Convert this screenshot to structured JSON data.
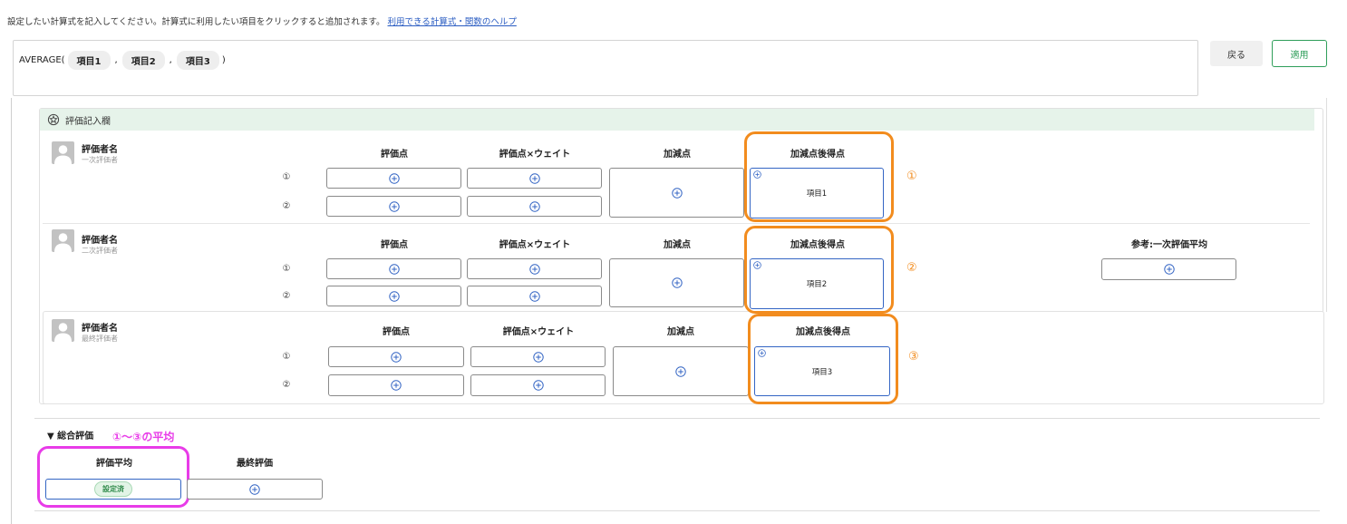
{
  "instruction": {
    "text": "設定したい計算式を記入してください。計算式に利用したい項目をクリックすると追加されます。",
    "help_link": "利用できる計算式・関数のヘルプ"
  },
  "formula": {
    "func": "AVERAGE(",
    "items": [
      "項目1",
      "項目2",
      "項目3"
    ],
    "separator": ",",
    "close": ")"
  },
  "buttons": {
    "back": "戻る",
    "apply": "適用"
  },
  "panel": {
    "title": "評価記入欄"
  },
  "columns": {
    "score": "評価点",
    "weighted": "評価点×ウェイト",
    "adjust": "加減点",
    "after": "加減点後得点",
    "reference": "参考:一次評価平均"
  },
  "row_numbers": [
    "①",
    "②"
  ],
  "evaluators": [
    {
      "name": "評価者名",
      "role": "一次評価者",
      "item": "項目1",
      "annotation": "①"
    },
    {
      "name": "評価者名",
      "role": "二次評価者",
      "item": "項目2",
      "annotation": "②"
    },
    {
      "name": "評価者名",
      "role": "最終評価者",
      "item": "項目3",
      "annotation": "③"
    }
  ],
  "summary": {
    "title": "▼ 総合評価",
    "note": "①〜③の平均",
    "avg_label": "評価平均",
    "final_label": "最終評価",
    "badge": "設定済"
  },
  "colors": {
    "orange": "#f28c1e",
    "magenta": "#e83ce8",
    "blue": "#3465c4",
    "green": "#2f9e5a"
  },
  "icons": [
    "plus-circle-icon",
    "settings-icon",
    "avatar-icon"
  ]
}
